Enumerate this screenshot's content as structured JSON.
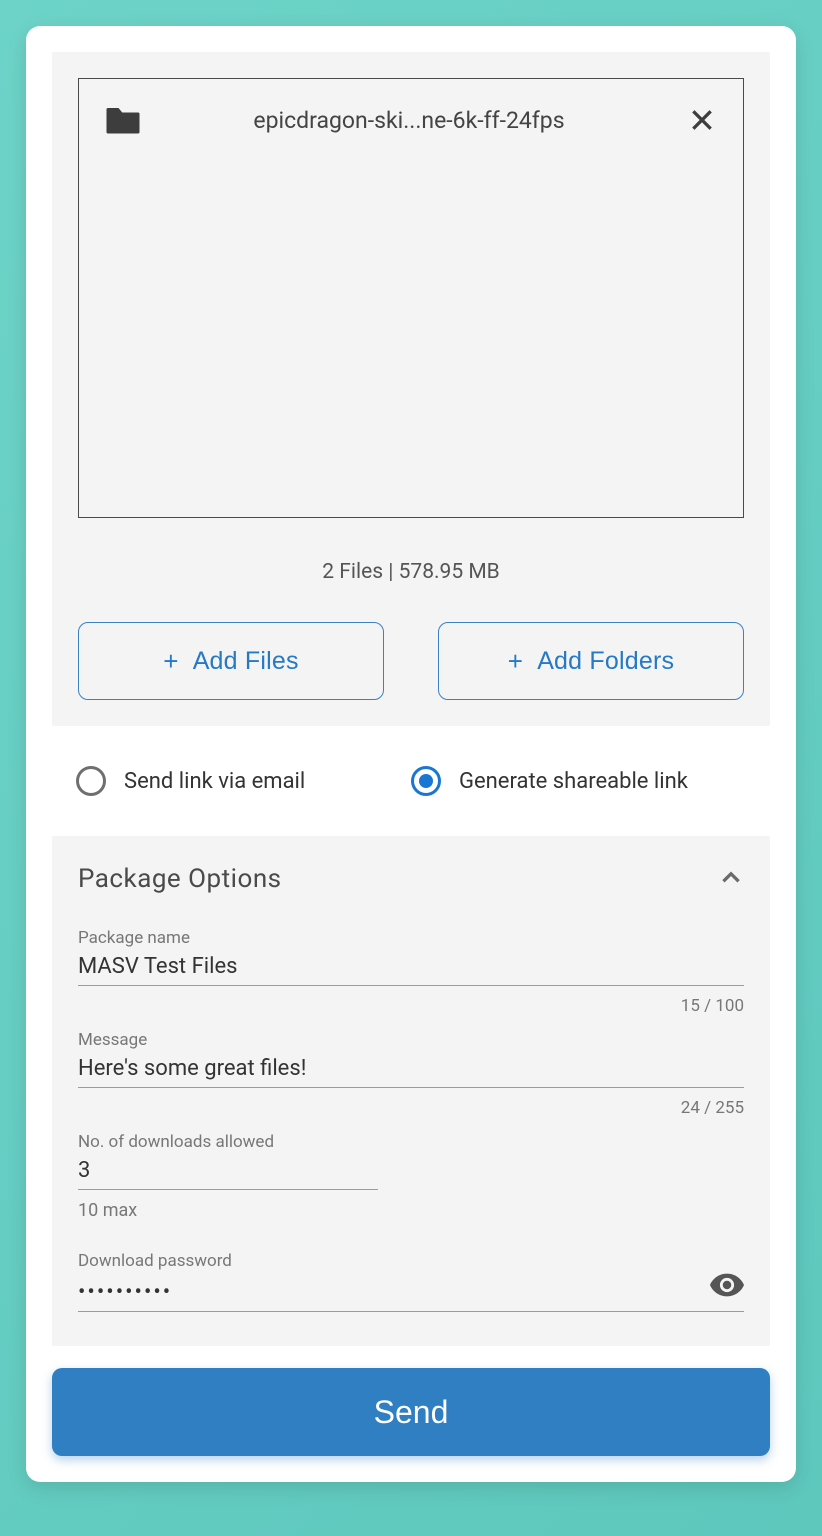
{
  "files": {
    "items": [
      {
        "name": "epicdragon-ski...ne-6k-ff-24fps"
      }
    ],
    "stats": "2 Files | 578.95 MB"
  },
  "buttons": {
    "add_files": "Add Files",
    "add_folders": "Add Folders",
    "send": "Send"
  },
  "share": {
    "email_label": "Send link via email",
    "link_label": "Generate shareable link",
    "selected": "link"
  },
  "options": {
    "title": "Package Options",
    "package_name": {
      "label": "Package name",
      "value": "MASV Test Files",
      "counter": "15 / 100"
    },
    "message": {
      "label": "Message",
      "value": "Here's some great files!",
      "counter": "24 / 255"
    },
    "downloads": {
      "label": "No. of downloads allowed",
      "value": "3",
      "helper": "10 max"
    },
    "password": {
      "label": "Download password",
      "value": "••••••••••"
    }
  }
}
